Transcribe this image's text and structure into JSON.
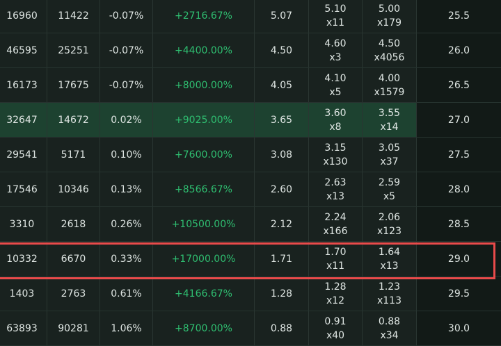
{
  "rows": [
    {
      "c0": "16960",
      "c1": "11422",
      "c2": "-0.07%",
      "c3": "+2716.67%",
      "c4": "5.07",
      "c5_price": "5.10",
      "c5_qty": "x11",
      "c6_price": "5.00",
      "c6_qty": "x179",
      "strike": "25.5"
    },
    {
      "c0": "46595",
      "c1": "25251",
      "c2": "-0.07%",
      "c3": "+4400.00%",
      "c4": "4.50",
      "c5_price": "4.60",
      "c5_qty": "x3",
      "c6_price": "4.50",
      "c6_qty": "x4056",
      "strike": "26.0"
    },
    {
      "c0": "16173",
      "c1": "17675",
      "c2": "-0.07%",
      "c3": "+8000.00%",
      "c4": "4.05",
      "c5_price": "4.10",
      "c5_qty": "x5",
      "c6_price": "4.00",
      "c6_qty": "x1579",
      "strike": "26.5"
    },
    {
      "c0": "32647",
      "c1": "14672",
      "c2": "0.02%",
      "c3": "+9025.00%",
      "c4": "3.65",
      "c5_price": "3.60",
      "c5_qty": "x8",
      "c6_price": "3.55",
      "c6_qty": "x14",
      "strike": "27.0"
    },
    {
      "c0": "29541",
      "c1": "5171",
      "c2": "0.10%",
      "c3": "+7600.00%",
      "c4": "3.08",
      "c5_price": "3.15",
      "c5_qty": "x130",
      "c6_price": "3.05",
      "c6_qty": "x37",
      "strike": "27.5"
    },
    {
      "c0": "17546",
      "c1": "10346",
      "c2": "0.13%",
      "c3": "+8566.67%",
      "c4": "2.60",
      "c5_price": "2.63",
      "c5_qty": "x13",
      "c6_price": "2.59",
      "c6_qty": "x5",
      "strike": "28.0"
    },
    {
      "c0": "3310",
      "c1": "2618",
      "c2": "0.26%",
      "c3": "+10500.00%",
      "c4": "2.12",
      "c5_price": "2.24",
      "c5_qty": "x166",
      "c6_price": "2.06",
      "c6_qty": "x123",
      "strike": "28.5"
    },
    {
      "c0": "10332",
      "c1": "6670",
      "c2": "0.33%",
      "c3": "+17000.00%",
      "c4": "1.71",
      "c5_price": "1.70",
      "c5_qty": "x11",
      "c6_price": "1.64",
      "c6_qty": "x13",
      "strike": "29.0"
    },
    {
      "c0": "1403",
      "c1": "2763",
      "c2": "0.61%",
      "c3": "+4166.67%",
      "c4": "1.28",
      "c5_price": "1.28",
      "c5_qty": "x12",
      "c6_price": "1.23",
      "c6_qty": "x113",
      "strike": "29.5"
    },
    {
      "c0": "63893",
      "c1": "90281",
      "c2": "1.06%",
      "c3": "+8700.00%",
      "c4": "0.88",
      "c5_price": "0.91",
      "c5_qty": "x40",
      "c6_price": "0.88",
      "c6_qty": "x34",
      "strike": "30.0"
    }
  ],
  "colors": {
    "accent_green": "#2fbf71",
    "highlight_row": "#1d4230",
    "selection_border": "#e94b4b"
  }
}
